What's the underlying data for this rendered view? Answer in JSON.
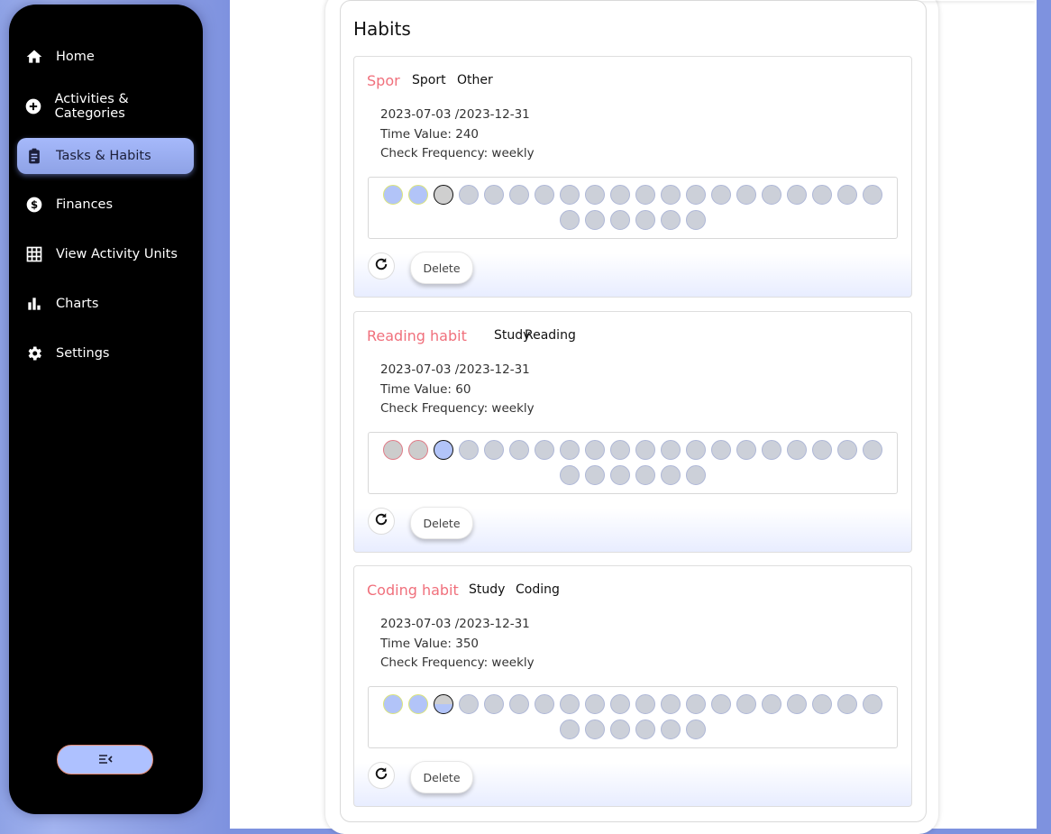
{
  "sidebar": {
    "items": [
      {
        "label": "Home",
        "icon": "home-icon",
        "active": false
      },
      {
        "label": "Activities & Categories",
        "icon": "plus-circle-icon",
        "active": false
      },
      {
        "label": "Tasks & Habits",
        "icon": "clipboard-icon",
        "active": true
      },
      {
        "label": "Finances",
        "icon": "dollar-circle-icon",
        "active": false
      },
      {
        "label": "View Activity Units",
        "icon": "grid-table-icon",
        "active": false
      },
      {
        "label": "Charts",
        "icon": "bar-chart-icon",
        "active": false
      },
      {
        "label": "Settings",
        "icon": "gear-icon",
        "active": false
      }
    ],
    "collapse_icon": "collapse-menu-icon"
  },
  "habits_panel": {
    "title": "Habits",
    "habits": [
      {
        "name": "Spor",
        "tags": [
          "Sport",
          "Other"
        ],
        "dates": "2023-07-03 /2023-12-31",
        "time_value": "Time Value: 240",
        "check_frequency": "Check Frequency: weekly",
        "checks": [
          "done",
          "done",
          "current-gray"
        ],
        "total_checks": 26,
        "delete_label": "Delete"
      },
      {
        "name": "Reading habit",
        "tags": [
          "Study",
          "Reading"
        ],
        "dates": "2023-07-03 /2023-12-31",
        "time_value": "Time Value: 60",
        "check_frequency": "Check Frequency: weekly",
        "checks": [
          "missed",
          "missed",
          "current-blue"
        ],
        "total_checks": 26,
        "delete_label": "Delete"
      },
      {
        "name": "Coding habit",
        "tags": [
          "Study",
          "Coding"
        ],
        "dates": "2023-07-03 /2023-12-31",
        "time_value": "Time Value: 350",
        "check_frequency": "Check Frequency: weekly",
        "checks": [
          "done",
          "done",
          "current-split"
        ],
        "total_checks": 26,
        "delete_label": "Delete"
      }
    ]
  },
  "colors": {
    "accent": "#aec1ff",
    "habit_name": "#f0707c",
    "sidebar_bg": "#000000"
  }
}
